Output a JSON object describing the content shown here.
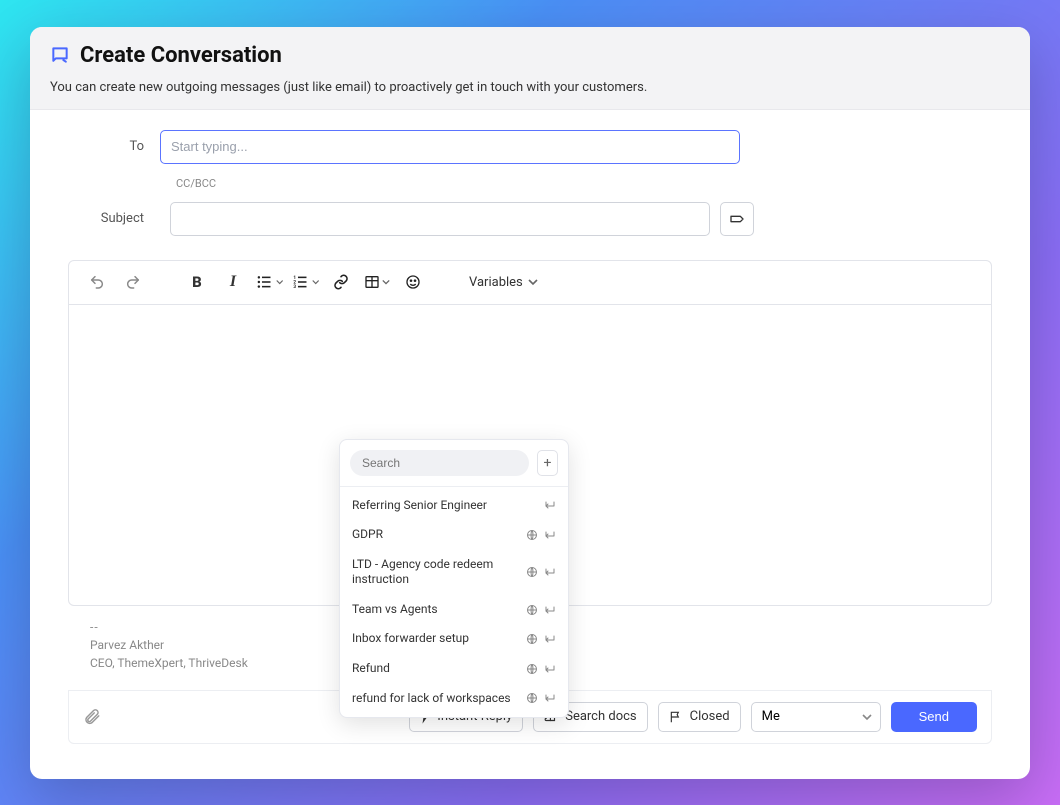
{
  "header": {
    "title": "Create Conversation",
    "subtitle": "You can create new outgoing messages (just like email) to proactively get in touch with your customers."
  },
  "form": {
    "to_label": "To",
    "to_placeholder": "Start typing...",
    "ccbcc_label": "CC/BCC",
    "subject_label": "Subject"
  },
  "toolbar": {
    "variables_label": "Variables"
  },
  "signature": {
    "dash": "--",
    "name": "Parvez Akther",
    "title": "CEO, ThemeXpert, ThriveDesk"
  },
  "footer": {
    "instant_reply": "Instant Reply",
    "search_docs": "Search docs",
    "closed": "Closed",
    "assignee": "Me",
    "send": "Send"
  },
  "popover": {
    "search_placeholder": "Search",
    "items": [
      {
        "label": "Referring Senior Engineer",
        "globe": false,
        "enter": true
      },
      {
        "label": "GDPR",
        "globe": true,
        "enter": true
      },
      {
        "label": "LTD - Agency code redeem instruction",
        "globe": true,
        "enter": true
      },
      {
        "label": "Team vs Agents",
        "globe": true,
        "enter": true
      },
      {
        "label": "Inbox forwarder setup",
        "globe": true,
        "enter": true
      },
      {
        "label": "Refund",
        "globe": true,
        "enter": true
      },
      {
        "label": "refund for lack of workspaces",
        "globe": true,
        "enter": true
      }
    ]
  }
}
